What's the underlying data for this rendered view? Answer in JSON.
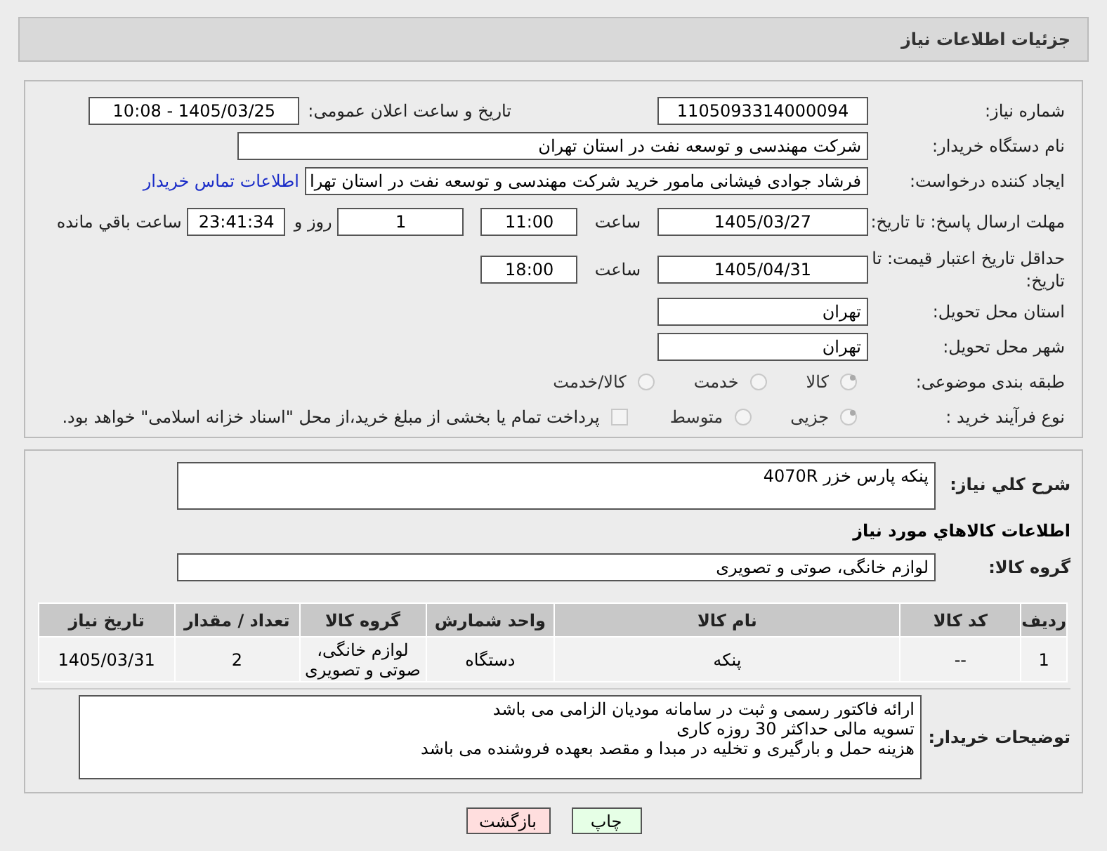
{
  "header": {
    "title": "جزئیات اطلاعات نیاز"
  },
  "form": {
    "need_number": {
      "label": "شماره نیاز:",
      "value": "1105093314000094"
    },
    "announce": {
      "label": "تاریخ و ساعت اعلان عمومی:",
      "value": "1405/03/25 - 10:08"
    },
    "buyer": {
      "label": "نام دستگاه خریدار:",
      "value": "شرکت مهندسی و توسعه نفت در استان تهران"
    },
    "creator": {
      "label": "ایجاد کننده درخواست:",
      "value": "فرشاد جوادی فیشانی مامور خرید شرکت مهندسی و توسعه نفت در استان تهرا",
      "link": "اطلاعات تماس خریدار"
    },
    "deadline": {
      "label": "مهلت ارسال پاسخ: تا تاریخ:",
      "date": "1405/03/27",
      "time_label": "ساعت",
      "time": "11:00",
      "days": "1",
      "days_label": "روز و",
      "remaining": "23:41:34",
      "remaining_label": "ساعت باقي مانده"
    },
    "validity": {
      "label": "حداقل تاریخ اعتبار قیمت: تا تاریخ:",
      "date": "1405/04/31",
      "time_label": "ساعت",
      "time": "18:00"
    },
    "province": {
      "label": "استان محل تحویل:",
      "value": "تهران"
    },
    "city": {
      "label": "شهر محل تحویل:",
      "value": "تهران"
    },
    "category": {
      "label": "طبقه بندی موضوعی:",
      "options": [
        {
          "label": "کالا",
          "selected": true
        },
        {
          "label": "خدمت",
          "selected": false
        },
        {
          "label": "کالا/خدمت",
          "selected": false
        }
      ]
    },
    "process": {
      "label": "نوع فرآیند خرید :",
      "options": [
        {
          "label": "جزیی",
          "selected": true
        },
        {
          "label": "متوسط",
          "selected": false
        }
      ],
      "treasury": {
        "label": "پرداخت تمام یا بخشی از مبلغ خرید،از محل \"اسناد خزانه اسلامی\" خواهد بود.",
        "checked": false
      }
    }
  },
  "description": {
    "label": "شرح کلي نیاز:",
    "value": "پنکه پارس خزر 4070R"
  },
  "goods_heading": "اطلاعات کالاهاي مورد نياز",
  "goods_group": {
    "label": "گروه کالا:",
    "value": "لوازم خانگی، صوتی و تصویری"
  },
  "table": {
    "columns": [
      "ردیف",
      "کد کالا",
      "نام کالا",
      "واحد شمارش",
      "گروه کالا",
      "تعداد / مقدار",
      "تاریخ نیاز"
    ],
    "rows": [
      [
        "1",
        "--",
        "پنکه",
        "دستگاه",
        "لوازم خانگی، صوتی و تصویری",
        "2",
        "1405/03/31"
      ]
    ]
  },
  "buyer_notes": {
    "label": "توضیحات خریدار:",
    "lines": [
      "ارائه فاکتور رسمی و ثبت در سامانه مودیان الزامی می باشد",
      "تسویه مالی حداکثر 30 روزه کاری",
      "هزینه حمل و بارگیری و تخلیه در مبدا و مقصد بعهده فروشنده می باشد"
    ]
  },
  "buttons": [
    {
      "label": "چاپ",
      "kind": "print"
    },
    {
      "label": "بازگشت",
      "kind": "back"
    }
  ]
}
